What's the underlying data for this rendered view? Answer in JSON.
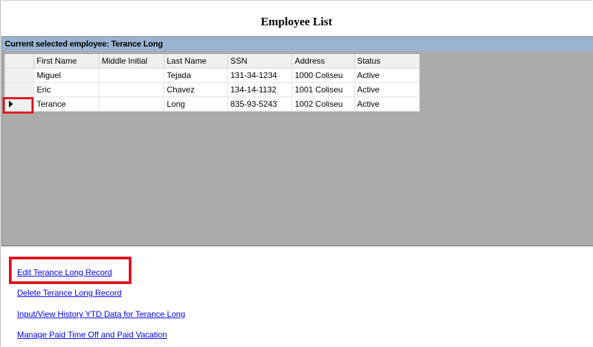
{
  "title": "Employee List",
  "grid": {
    "caption": "Current selected employee: Terance Long",
    "columns": [
      "First Name",
      "Middle Initial",
      "Last Name",
      "SSN",
      "Address",
      "Status"
    ],
    "rows": [
      {
        "first": "Miguel",
        "middle": "",
        "last": "Tejada",
        "ssn": "131-34-1234",
        "address": "1000 Coliseu",
        "status": "Active"
      },
      {
        "first": "Eric",
        "middle": "",
        "last": "Chavez",
        "ssn": "134-14-1132",
        "address": "1001 Coliseu",
        "status": "Active"
      },
      {
        "first": "Terance",
        "middle": "",
        "last": "Long",
        "ssn": "835-93-5243",
        "address": "1002 Coliseu",
        "status": "Active"
      }
    ]
  },
  "links": {
    "edit": "Edit Terance Long Record",
    "delete": "Delete Terance Long Record",
    "ytd": "Input/View History YTD Data for Terance Long",
    "pto": "Manage Paid Time Off and Paid Vacation"
  },
  "colors": {
    "highlight": "#e3101a",
    "caption_bg": "#99b4d1",
    "grid_bg": "#ababab",
    "link": "#0000ee"
  }
}
